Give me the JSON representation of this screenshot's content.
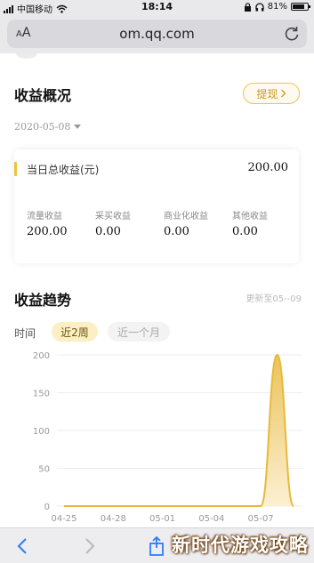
{
  "status_bar": {
    "carrier": "中国移动",
    "time": "18:14",
    "battery": "81%",
    "battery_level": 0.81
  },
  "browser": {
    "text_size": "AA",
    "url": "om.qq.com"
  },
  "overview": {
    "title": "收益概况",
    "withdraw_label": "提现",
    "date": "2020-05-08",
    "total_label": "当日总收益(元)",
    "total_value": "200.00",
    "metrics": [
      {
        "label": "流量收益",
        "value": "200.00"
      },
      {
        "label": "采买收益",
        "value": "0.00"
      },
      {
        "label": "商业化收益",
        "value": "0.00"
      },
      {
        "label": "其他收益",
        "value": "0.00"
      }
    ]
  },
  "trend": {
    "title": "收益趋势",
    "updated_text": "更新至05--09",
    "time_label": "时间",
    "chips": [
      {
        "label": "近2周",
        "active": true
      },
      {
        "label": "近一个月",
        "active": false
      }
    ]
  },
  "chart_data": {
    "type": "area",
    "x": [
      "04-25",
      "04-26",
      "04-27",
      "04-28",
      "04-29",
      "04-30",
      "05-01",
      "05-02",
      "05-03",
      "05-04",
      "05-05",
      "05-06",
      "05-07",
      "05-08",
      "05-09"
    ],
    "values": [
      0,
      0,
      0,
      0,
      0,
      0,
      0,
      0,
      0,
      0,
      0,
      0,
      0,
      200,
      0
    ],
    "x_tick_labels": [
      "04-25",
      "04-28",
      "05-01",
      "05-04",
      "05-07"
    ],
    "y_tick_labels": [
      "0",
      "50",
      "100",
      "150",
      "200"
    ],
    "ylim": [
      0,
      200
    ],
    "grid": true,
    "colors": {
      "line": "#e8b93a",
      "fill_top": "#ecc35a",
      "fill_bottom": "#fbf0d2",
      "grid": "#eeeeee",
      "axis_text": "#999999"
    }
  },
  "watermark": "新时代游戏攻略",
  "icons": {
    "back": "back-arrow-icon",
    "forward": "forward-arrow-icon",
    "share": "share-icon",
    "reload": "reload-icon",
    "wifi": "wifi-icon",
    "lock": "lock-icon",
    "headphones": "headphones-icon",
    "battery": "battery-icon"
  }
}
